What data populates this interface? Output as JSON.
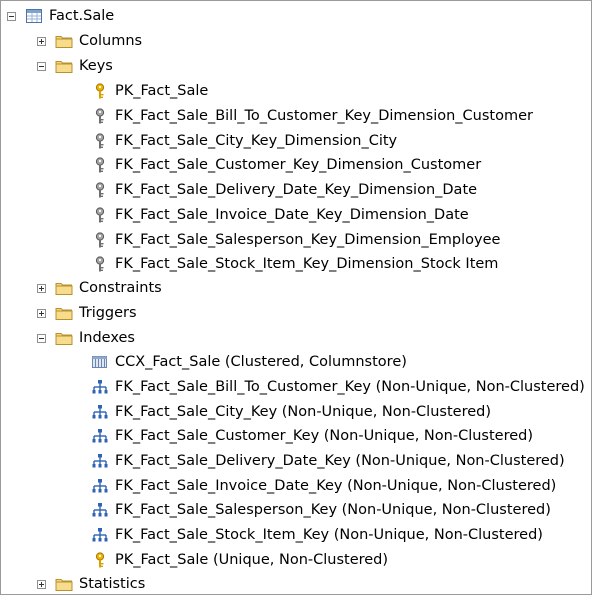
{
  "tree": {
    "root": {
      "label": "Fact.Sale",
      "expanded": true,
      "icon": "table-icon"
    },
    "folders": {
      "columns": {
        "label": "Columns",
        "expanded": false,
        "icon": "folder-icon"
      },
      "keys": {
        "label": "Keys",
        "expanded": true,
        "icon": "folder-icon"
      },
      "constraints": {
        "label": "Constraints",
        "expanded": false,
        "icon": "folder-icon"
      },
      "triggers": {
        "label": "Triggers",
        "expanded": false,
        "icon": "folder-icon"
      },
      "indexes": {
        "label": "Indexes",
        "expanded": true,
        "icon": "folder-icon"
      },
      "statistics": {
        "label": "Statistics",
        "expanded": false,
        "icon": "folder-icon"
      }
    },
    "keys": [
      {
        "label": "PK_Fact_Sale",
        "icon": "primary-key-icon"
      },
      {
        "label": "FK_Fact_Sale_Bill_To_Customer_Key_Dimension_Customer",
        "icon": "foreign-key-icon"
      },
      {
        "label": "FK_Fact_Sale_City_Key_Dimension_City",
        "icon": "foreign-key-icon"
      },
      {
        "label": "FK_Fact_Sale_Customer_Key_Dimension_Customer",
        "icon": "foreign-key-icon"
      },
      {
        "label": "FK_Fact_Sale_Delivery_Date_Key_Dimension_Date",
        "icon": "foreign-key-icon"
      },
      {
        "label": "FK_Fact_Sale_Invoice_Date_Key_Dimension_Date",
        "icon": "foreign-key-icon"
      },
      {
        "label": "FK_Fact_Sale_Salesperson_Key_Dimension_Employee",
        "icon": "foreign-key-icon"
      },
      {
        "label": "FK_Fact_Sale_Stock_Item_Key_Dimension_Stock Item",
        "icon": "foreign-key-icon"
      }
    ],
    "indexes": [
      {
        "label": "CCX_Fact_Sale (Clustered, Columnstore)",
        "icon": "columnstore-index-icon"
      },
      {
        "label": "FK_Fact_Sale_Bill_To_Customer_Key (Non-Unique, Non-Clustered)",
        "icon": "nonclustered-index-icon"
      },
      {
        "label": "FK_Fact_Sale_City_Key (Non-Unique, Non-Clustered)",
        "icon": "nonclustered-index-icon"
      },
      {
        "label": "FK_Fact_Sale_Customer_Key (Non-Unique, Non-Clustered)",
        "icon": "nonclustered-index-icon"
      },
      {
        "label": "FK_Fact_Sale_Delivery_Date_Key (Non-Unique, Non-Clustered)",
        "icon": "nonclustered-index-icon"
      },
      {
        "label": "FK_Fact_Sale_Invoice_Date_Key (Non-Unique, Non-Clustered)",
        "icon": "nonclustered-index-icon"
      },
      {
        "label": "FK_Fact_Sale_Salesperson_Key (Non-Unique, Non-Clustered)",
        "icon": "nonclustered-index-icon"
      },
      {
        "label": "FK_Fact_Sale_Stock_Item_Key (Non-Unique, Non-Clustered)",
        "icon": "nonclustered-index-icon"
      },
      {
        "label": "PK_Fact_Sale (Unique, Non-Clustered)",
        "icon": "primary-key-icon"
      }
    ]
  },
  "colors": {
    "folder": "#e8c15a",
    "primary_key": "#e0a800",
    "foreign_key": "#8a8a8a",
    "index": "#2f63b4"
  }
}
